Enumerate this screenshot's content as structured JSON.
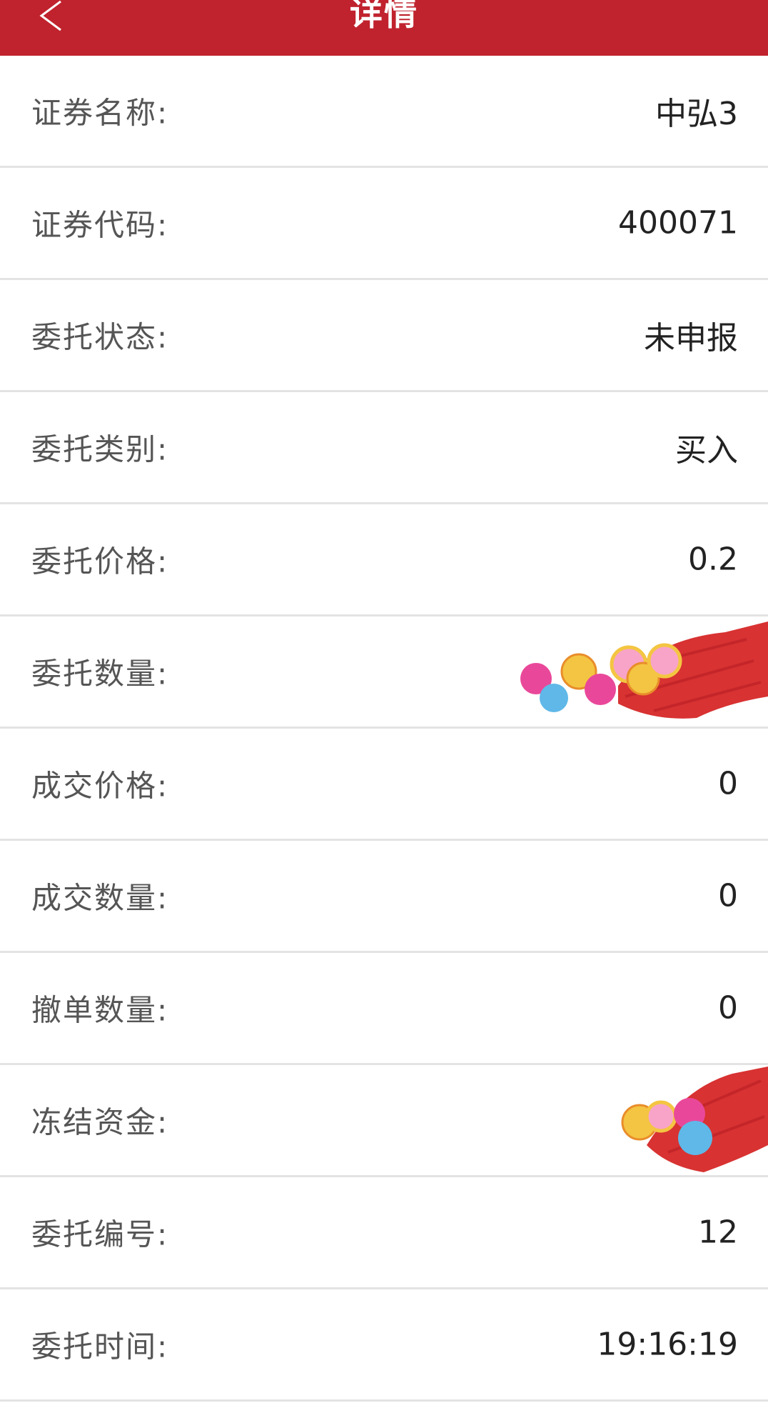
{
  "header": {
    "title": "详情",
    "back_icon": "chevron-left-icon",
    "color": "#c0232e"
  },
  "rows": [
    {
      "label": "证券名称:",
      "value": "中弘3"
    },
    {
      "label": "证券代码:",
      "value": "400071"
    },
    {
      "label": "委托状态:",
      "value": "未申报"
    },
    {
      "label": "委托类别:",
      "value": "买入"
    },
    {
      "label": "委托价格:",
      "value": "0.2"
    },
    {
      "label": "委托数量:",
      "value": ""
    },
    {
      "label": "成交价格:",
      "value": "0"
    },
    {
      "label": "成交数量:",
      "value": "0"
    },
    {
      "label": "撤单数量:",
      "value": "0"
    },
    {
      "label": "冻结资金:",
      "value": ""
    },
    {
      "label": "委托编号:",
      "value": "12"
    },
    {
      "label": "委托时间:",
      "value": "19:16:19"
    }
  ]
}
